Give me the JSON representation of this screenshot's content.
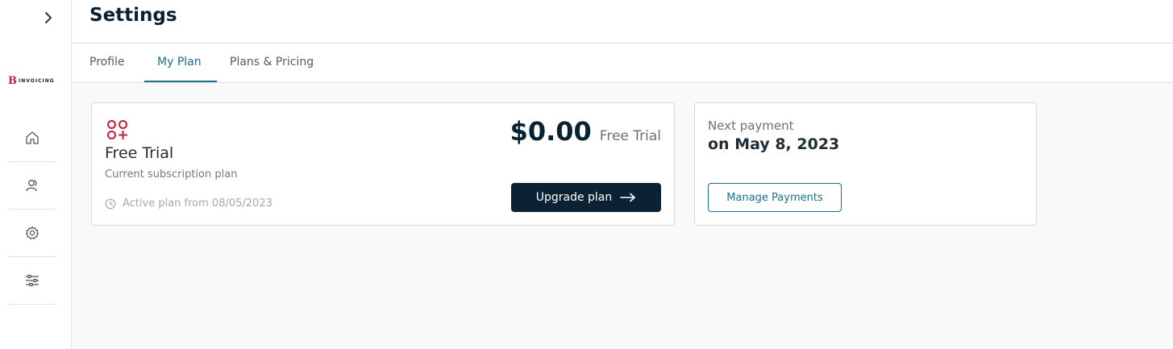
{
  "sidebar": {
    "logo_mark": "B",
    "logo_text": "INVOICING",
    "nav_items": [
      "home-icon",
      "users-icon",
      "settings-icon",
      "sliders-icon"
    ]
  },
  "header": {
    "title": "Settings"
  },
  "tabs": [
    {
      "label": "Profile",
      "active": false
    },
    {
      "label": "My Plan",
      "active": true
    },
    {
      "label": "Plans & Pricing",
      "active": false
    }
  ],
  "plan": {
    "name": "Free Trial",
    "subtitle": "Current subscription plan",
    "active_from": "Active plan from 08/05/2023",
    "price": "$0.00",
    "price_label": "Free Trial",
    "upgrade_label": "Upgrade plan"
  },
  "payment": {
    "label": "Next payment",
    "date": "on May 8, 2023",
    "manage_label": "Manage Payments"
  },
  "colors": {
    "primary_dark": "#0a2233",
    "accent": "#1b6f8a",
    "brand_red": "#c21f3a"
  }
}
